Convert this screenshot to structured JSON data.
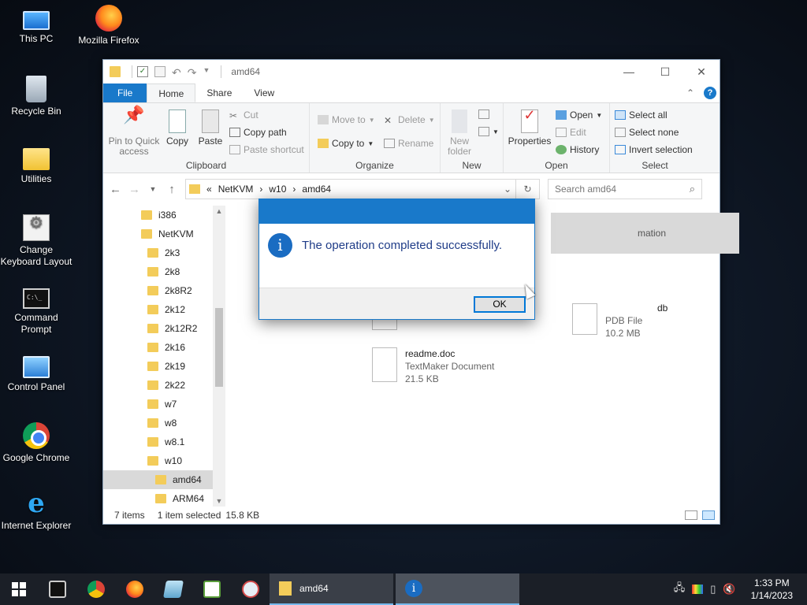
{
  "desktop": {
    "icons": [
      {
        "label": "This PC",
        "icon": "computer-icon"
      },
      {
        "label": "Mozilla Firefox",
        "icon": "firefox-icon"
      },
      {
        "label": "Recycle Bin",
        "icon": "recycle-bin-icon"
      },
      {
        "label": "Utilities",
        "icon": "folder-icon"
      },
      {
        "label": "Change Keyboard Layout",
        "icon": "keyboard-settings-icon"
      },
      {
        "label": "Command Prompt",
        "icon": "cmd-icon"
      },
      {
        "label": "Control Panel",
        "icon": "control-panel-icon"
      },
      {
        "label": "Google Chrome",
        "icon": "chrome-icon"
      },
      {
        "label": "Internet Explorer",
        "icon": "ie-icon"
      }
    ]
  },
  "explorer": {
    "title": "amd64",
    "tabs": [
      "File",
      "Home",
      "Share",
      "View"
    ],
    "active_tab": "Home",
    "ribbon": {
      "clipboard": {
        "label": "Clipboard",
        "pin": "Pin to Quick access",
        "copy": "Copy",
        "paste": "Paste",
        "cut": "Cut",
        "copy_path": "Copy path",
        "paste_shortcut": "Paste shortcut"
      },
      "organize": {
        "label": "Organize",
        "move_to": "Move to",
        "copy_to": "Copy to",
        "delete": "Delete",
        "rename": "Rename"
      },
      "new": {
        "label": "New",
        "new_folder": "New folder"
      },
      "open": {
        "label": "Open",
        "properties": "Properties",
        "open": "Open",
        "edit": "Edit",
        "history": "History"
      },
      "select": {
        "label": "Select",
        "select_all": "Select all",
        "select_none": "Select none",
        "invert": "Invert selection"
      }
    },
    "address": {
      "prefix": "«",
      "crumbs": [
        "NetKVM",
        "w10",
        "amd64"
      ],
      "separator": "›"
    },
    "search": {
      "placeholder": "Search amd64"
    },
    "tree": [
      {
        "label": "i386",
        "indent": 0
      },
      {
        "label": "NetKVM",
        "indent": 0
      },
      {
        "label": "2k3",
        "indent": 1
      },
      {
        "label": "2k8",
        "indent": 1
      },
      {
        "label": "2k8R2",
        "indent": 1
      },
      {
        "label": "2k12",
        "indent": 1
      },
      {
        "label": "2k12R2",
        "indent": 1
      },
      {
        "label": "2k16",
        "indent": 1
      },
      {
        "label": "2k19",
        "indent": 1
      },
      {
        "label": "2k22",
        "indent": 1
      },
      {
        "label": "w7",
        "indent": 1
      },
      {
        "label": "w8",
        "indent": 1
      },
      {
        "label": "w8.1",
        "indent": 1
      },
      {
        "label": "w10",
        "indent": 1
      },
      {
        "label": "amd64",
        "indent": 2,
        "selected": true
      },
      {
        "label": "ARM64",
        "indent": 2
      }
    ],
    "files": {
      "partial_type": "mation",
      "pdb_partial_name": "db",
      "pdb_type": "PDB File",
      "pdb_size": "10.2 MB",
      "readme_name": "readme.doc",
      "readme_type": "TextMaker Document",
      "readme_size": "21.5 KB"
    },
    "status": {
      "items": "7 items",
      "selected": "1 item selected",
      "size": "15.8 KB"
    }
  },
  "dialog": {
    "message": "The operation completed successfully.",
    "ok": "OK"
  },
  "taskbar": {
    "explorer_task": "amd64",
    "time": "1:33 PM",
    "date": "1/14/2023"
  }
}
